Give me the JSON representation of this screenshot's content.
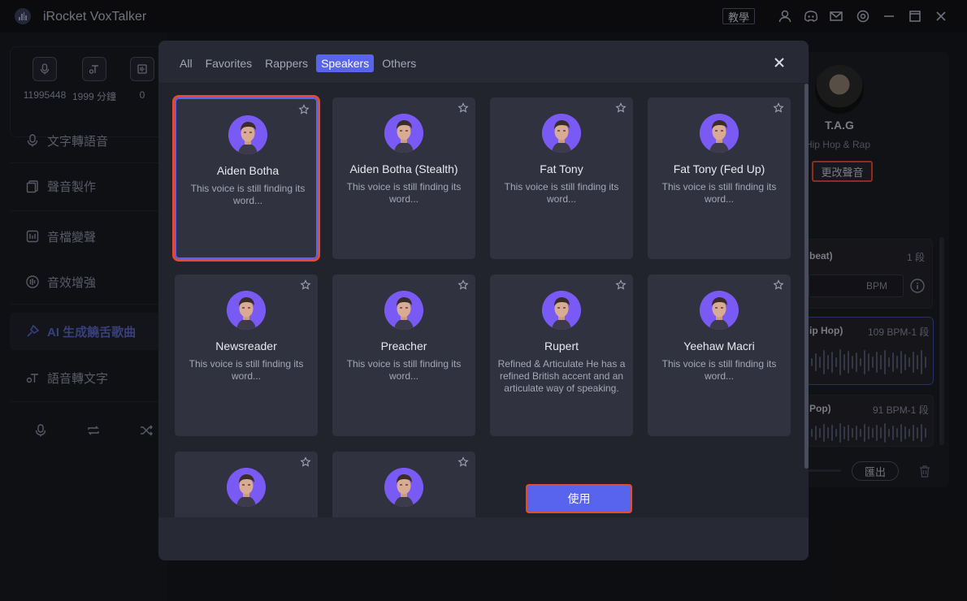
{
  "app": {
    "title": "iRocket VoxTalker",
    "tutorial_label": "教學"
  },
  "titlebar_icons": [
    "user-icon",
    "discord-icon",
    "mail-icon",
    "settings-icon",
    "minimize-icon",
    "maximize-icon",
    "close-icon"
  ],
  "sidebar": {
    "stats": [
      {
        "icon": "mic-credit-icon",
        "value": "11995448"
      },
      {
        "icon": "text-credit-icon",
        "value": "1999 分鐘"
      },
      {
        "icon": "file-credit-icon",
        "value": "0"
      }
    ],
    "nav": [
      {
        "icon": "text-to-speech-icon",
        "label": "文字轉語音"
      },
      {
        "icon": "voice-production-icon",
        "label": "聲音製作"
      },
      {
        "icon": "audio-changer-icon",
        "label": "音檔變聲"
      },
      {
        "icon": "audio-enhance-icon",
        "label": "音效增強"
      },
      {
        "icon": "ai-rap-icon",
        "label": "AI 生成饒舌歌曲",
        "active": true
      },
      {
        "icon": "speech-to-text-icon",
        "label": "語音轉文字"
      }
    ],
    "tools": [
      "mic-icon",
      "loop-icon",
      "shuffle-icon"
    ]
  },
  "background": {
    "singer": {
      "name": "T.A.G",
      "genre": "Hip Hop & Rap",
      "change_label": "更改聲音"
    },
    "beat_header": "beat)",
    "beat_count": "1 段",
    "bpm_placeholder": "BPM",
    "tracks": [
      {
        "title": "ip Hop)",
        "meta": "109 BPM-1 段"
      },
      {
        "title": "Pop)",
        "meta": "91 BPM-1 段"
      }
    ],
    "export_label": "匯出"
  },
  "modal": {
    "tabs": [
      "All",
      "Favorites",
      "Rappers",
      "Speakers",
      "Others"
    ],
    "active_tab": "Speakers",
    "use_label": "使用",
    "voices": [
      {
        "name": "Aiden Botha",
        "desc": "This voice is still finding its word...",
        "selected": true
      },
      {
        "name": "Aiden Botha (Stealth)",
        "desc": "This voice is still finding its word..."
      },
      {
        "name": "Fat Tony",
        "desc": "This voice is still finding its word..."
      },
      {
        "name": "Fat Tony (Fed Up)",
        "desc": "This voice is still finding its word..."
      },
      {
        "name": "Newsreader",
        "desc": "This voice is still finding its word..."
      },
      {
        "name": "Preacher",
        "desc": "This voice is still finding its word..."
      },
      {
        "name": "Rupert",
        "desc": "Refined & Articulate He has a refined British accent and an articulate way of speaking."
      },
      {
        "name": "Yeehaw Macri",
        "desc": "This voice is still finding its word..."
      },
      {
        "name": "",
        "desc": ""
      },
      {
        "name": "",
        "desc": ""
      }
    ]
  },
  "colors": {
    "accent": "#5864ee",
    "highlight": "#e24b2e",
    "avatar_bg": "#7a5af5"
  }
}
